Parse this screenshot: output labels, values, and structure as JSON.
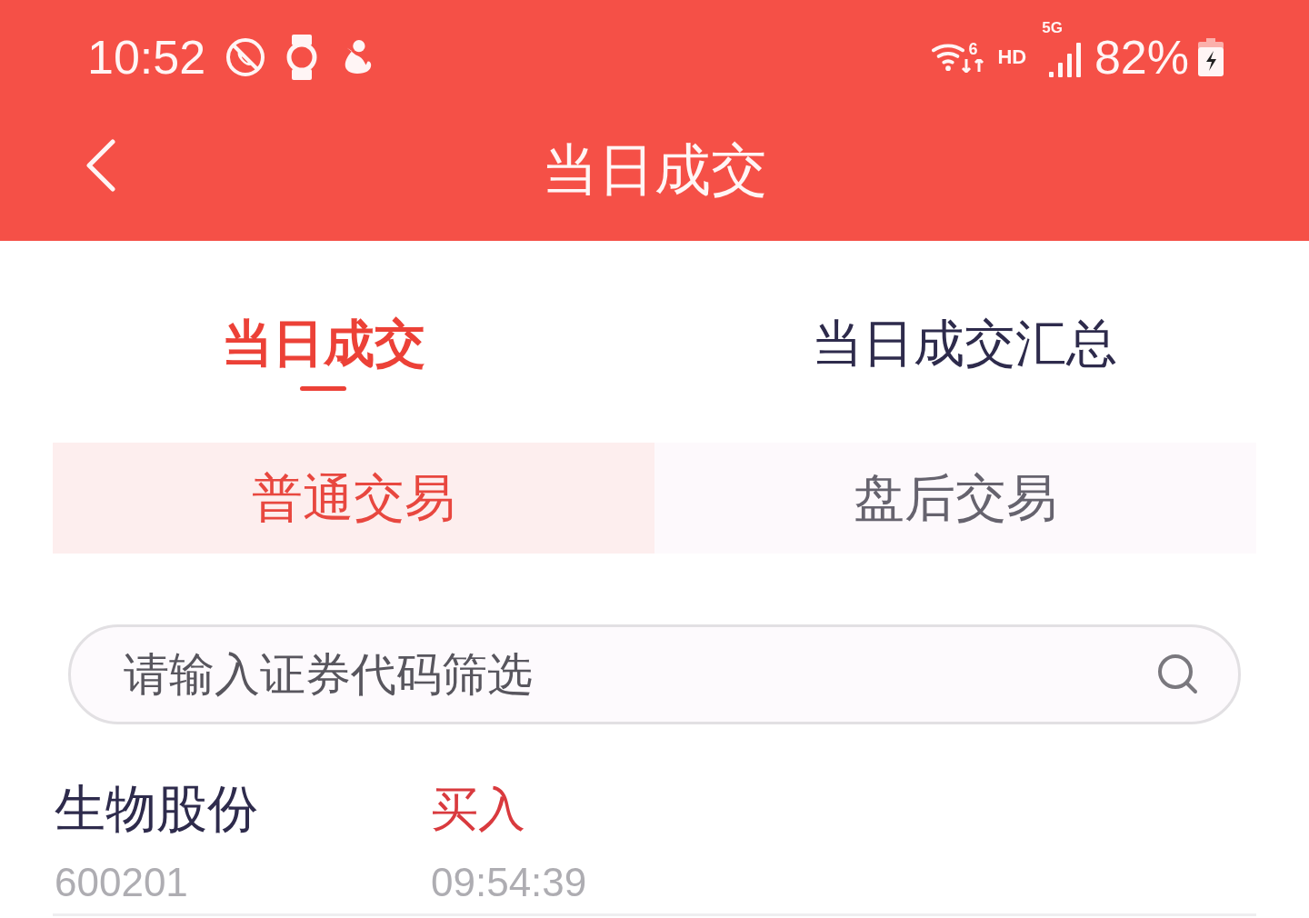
{
  "status_bar": {
    "time": "10:52",
    "wifi_label": "6",
    "hd_label": "HD",
    "network_label": "5G",
    "battery": "82%"
  },
  "header": {
    "title": "当日成交"
  },
  "tabs": [
    {
      "label": "当日成交",
      "selected": true
    },
    {
      "label": "当日成交汇总",
      "selected": false
    }
  ],
  "segments": [
    {
      "label": "普通交易",
      "selected": true
    },
    {
      "label": "盘后交易",
      "selected": false
    }
  ],
  "search": {
    "placeholder": "请输入证券代码筛选"
  },
  "trades": [
    {
      "name": "生物股份",
      "code": "600201",
      "side": "买入",
      "kind": "buy",
      "time": "09:54:39"
    }
  ]
}
